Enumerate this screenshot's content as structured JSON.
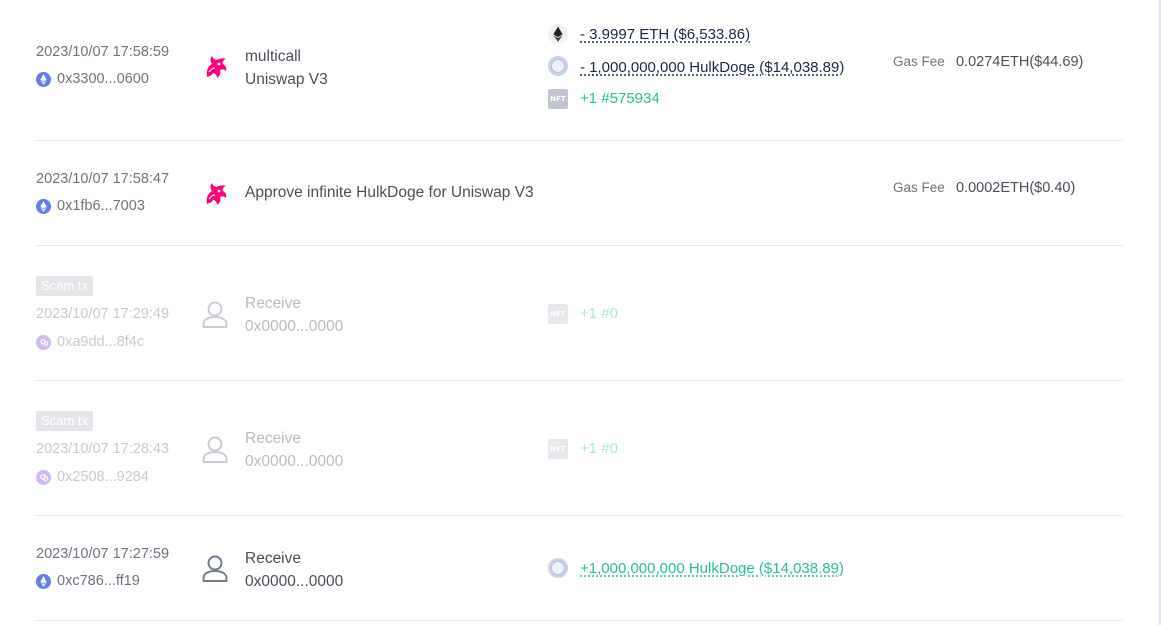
{
  "labels": {
    "gas_fee": "Gas Fee",
    "nft": "NFT"
  },
  "colors": {
    "uniswap_pink": "#ff007a",
    "income_green": "#27c193",
    "outgo_navy": "#192945",
    "eth_blue": "#627eea",
    "polygon_purple": "#8247e5"
  },
  "transactions": [
    {
      "time": "2023/10/07 17:58:59",
      "address": "0x3300...0600",
      "chain_icon": "ethereum-icon",
      "project_icon": "uniswap-icon",
      "name": "multicall",
      "sub": "Uniswap V3",
      "tokens": [
        {
          "icon": "eth-token-icon",
          "text": "- 3.9997 ETH ($6,533.86)"
        },
        {
          "icon": "hulkdoge-token-icon",
          "text": "- 1,000,000,000 HulkDoge ($14,038.89)"
        },
        {
          "icon": "nft-icon",
          "text": "+1 #575934"
        }
      ],
      "gas": "0.0274ETH($44.69)"
    },
    {
      "time": "2023/10/07 17:58:47",
      "address": "0x1fb6...7003",
      "chain_icon": "ethereum-icon",
      "project_icon": "uniswap-icon",
      "name": "Approve infinite HulkDoge for Uniswap V3",
      "gas": "0.0002ETH($0.40)"
    },
    {
      "badge": "Scam tx",
      "time": "2023/10/07 17:29:49",
      "address": "0xa9dd...8f4c",
      "chain_icon": "polygon-icon",
      "project_icon": "user-icon",
      "name": "Receive",
      "sub": "0x0000...0000",
      "tokens": [
        {
          "icon": "nft-icon",
          "text": "+1 #0"
        }
      ]
    },
    {
      "badge": "Scam tx",
      "time": "2023/10/07 17:28:43",
      "address": "0x2508...9284",
      "chain_icon": "polygon-icon",
      "project_icon": "user-icon",
      "name": "Receive",
      "sub": "0x0000...0000",
      "tokens": [
        {
          "icon": "nft-icon",
          "text": "+1 #0"
        }
      ]
    },
    {
      "time": "2023/10/07 17:27:59",
      "address": "0xc786...ff19",
      "chain_icon": "ethereum-icon",
      "project_icon": "user-icon",
      "name": "Receive",
      "sub": "0x0000...0000",
      "tokens": [
        {
          "icon": "hulkdoge-token-icon",
          "text": "+1,000,000,000 HulkDoge ($14,038.89)"
        }
      ]
    }
  ]
}
